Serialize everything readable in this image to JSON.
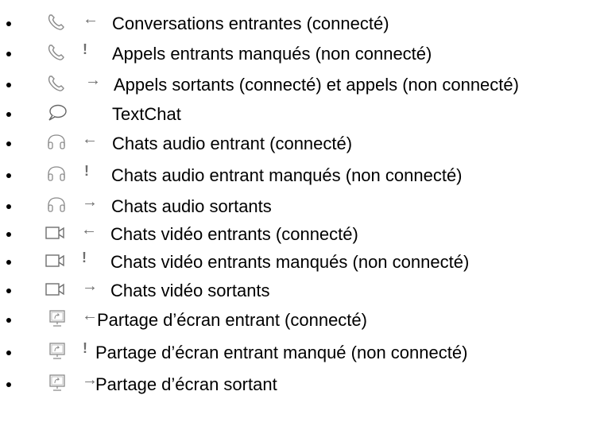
{
  "colors": {
    "icon": "#8a8a8a",
    "arrow": "#6e6e6e",
    "text": "#000000",
    "background": "#ffffff"
  },
  "items": [
    {
      "icon": "phone-icon",
      "direction": "←",
      "label": "Conversations entrantes (connecté)"
    },
    {
      "icon": "phone-icon",
      "direction": "!",
      "label": "Appels entrants manqués (non connecté)"
    },
    {
      "icon": "phone-icon",
      "direction": "→",
      "label": "Appels sortants (connecté) et appels (non connecté)"
    },
    {
      "icon": "chat-bubble-icon",
      "direction": "",
      "label": "TextChat"
    },
    {
      "icon": "headphones-icon",
      "direction": "←",
      "label": "Chats audio entrant (connecté)"
    },
    {
      "icon": "headphones-icon",
      "direction": "!",
      "label": "Chats audio entrant manqués (non connecté)"
    },
    {
      "icon": "headphones-icon",
      "direction": "→",
      "label": "Chats audio sortants"
    },
    {
      "icon": "video-camera-icon",
      "direction": "←",
      "label": "Chats vidéo entrants (connecté)"
    },
    {
      "icon": "video-camera-icon",
      "direction": "!",
      "label": "Chats vidéo entrants manqués (non connecté)"
    },
    {
      "icon": "video-camera-icon",
      "direction": "→",
      "label": "Chats vidéo sortants"
    },
    {
      "icon": "screen-share-icon",
      "direction": "←",
      "label": "Partage d’écran entrant (connecté)"
    },
    {
      "icon": "screen-share-icon",
      "direction": "!",
      "label": "Partage d’écran entrant manqué (non connecté)"
    },
    {
      "icon": "screen-share-icon",
      "direction": "→",
      "label": "Partage d’écran sortant"
    }
  ]
}
